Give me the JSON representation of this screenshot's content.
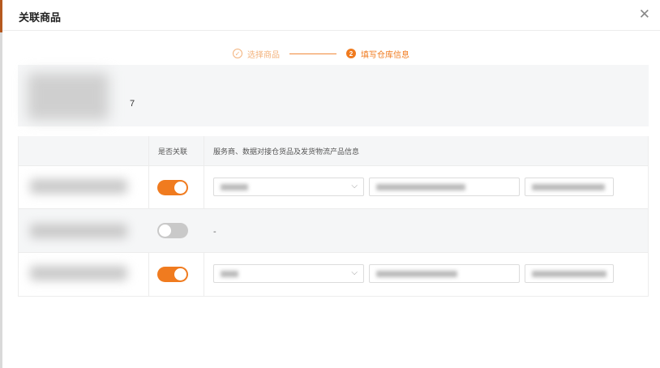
{
  "dialog": {
    "title": "关联商品",
    "close_icon": "close-icon"
  },
  "steps": [
    {
      "number": "✓",
      "label": "选择商品",
      "state": "done",
      "icon": "check-circle-icon"
    },
    {
      "number": "2",
      "label": "填写仓库信息",
      "state": "active"
    }
  ],
  "info": {
    "value": "7"
  },
  "table": {
    "headers": {
      "product": "",
      "linked": "是否关联",
      "info": "服务商、数据对接仓货品及发货物流产品信息"
    },
    "rows": [
      {
        "linked": true,
        "info_empty": ""
      },
      {
        "linked": false,
        "info_empty": "-"
      },
      {
        "linked": true,
        "info_empty": ""
      }
    ]
  },
  "colors": {
    "accent": "#f07b1f",
    "muted_accent": "#f3b27c",
    "panel_bg": "#f5f6f7"
  }
}
